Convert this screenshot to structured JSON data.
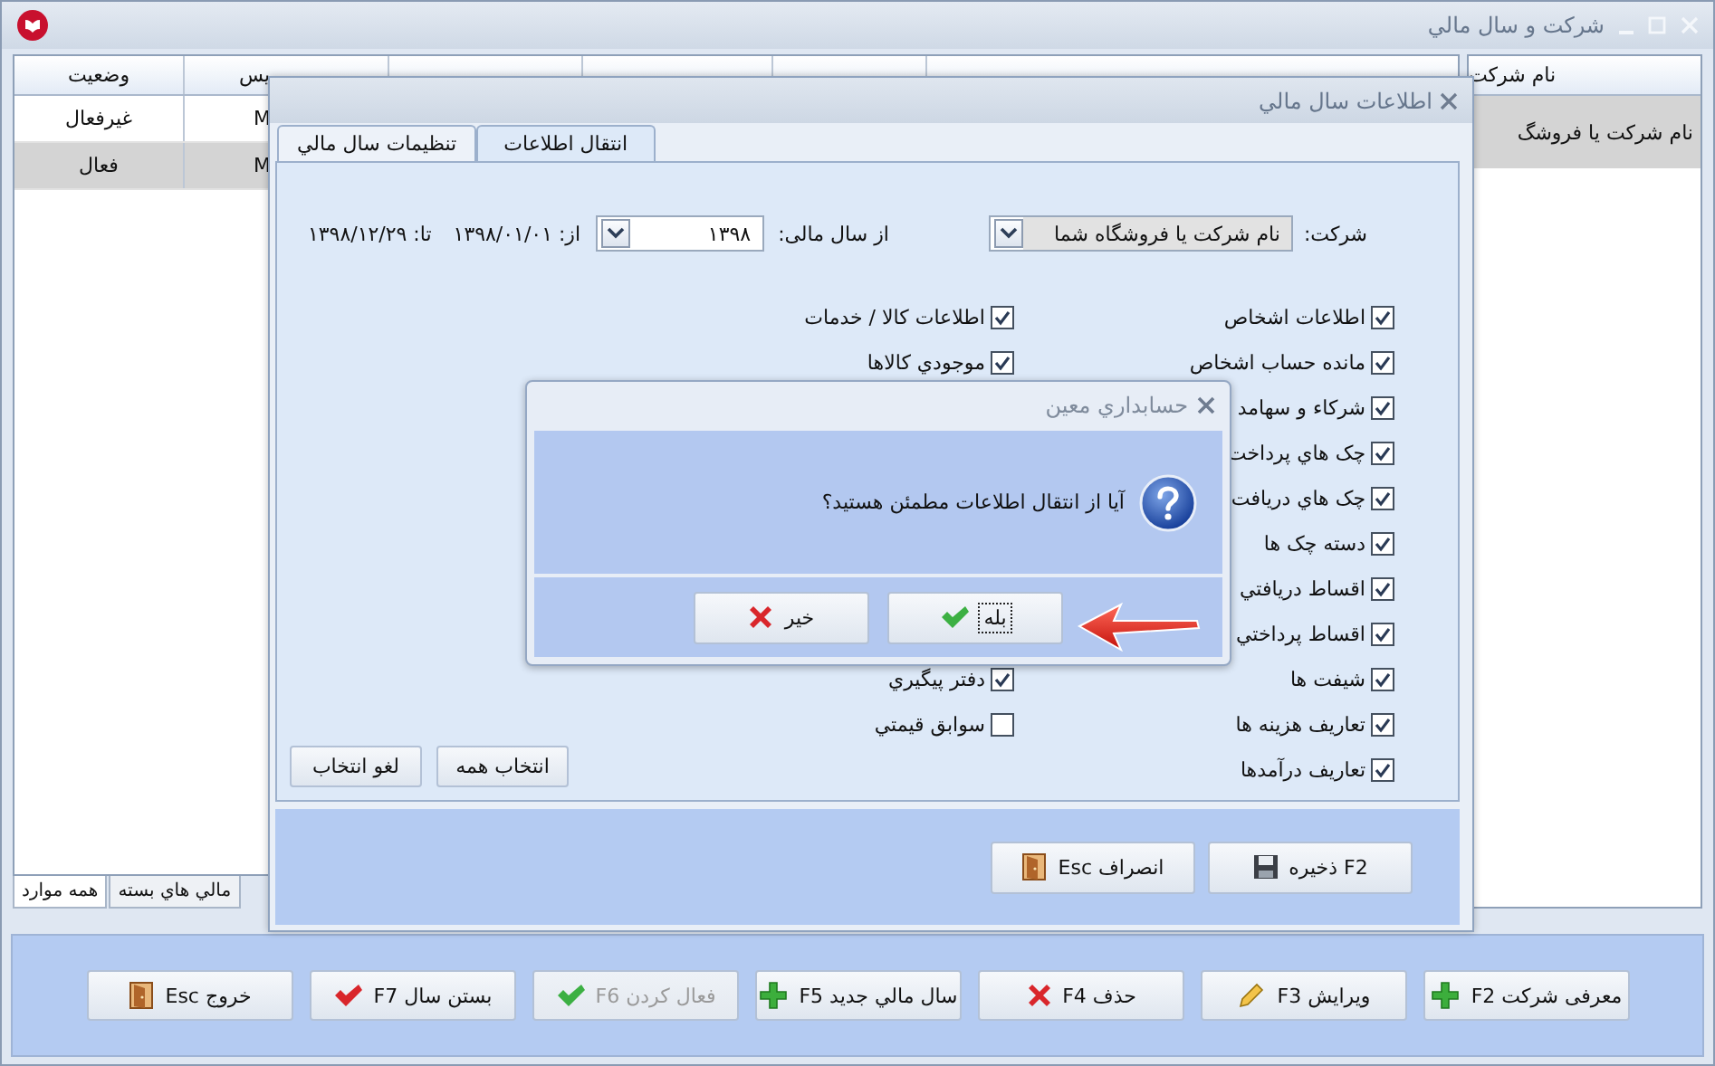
{
  "window": {
    "title": "شرکت و سال مالي"
  },
  "years_table": {
    "columns": [
      "یس",
      "وضعیت"
    ],
    "rows": [
      {
        "cells": [
          "M",
          "غیرفعال"
        ],
        "selected": false
      },
      {
        "cells": [
          "M",
          "فعال"
        ],
        "selected": true
      }
    ]
  },
  "companies_table": {
    "columns": [
      "نام شرکت"
    ],
    "rows": [
      {
        "cells": [
          "نام شرکت یا فروشگ"
        ],
        "selected": true
      }
    ]
  },
  "bottom_tabs": [
    {
      "label": "مالي هاي بسته",
      "selected": false
    },
    {
      "label": "همه موارد",
      "selected": true
    }
  ],
  "toolbar": [
    {
      "label": "معرفی شرکت F2",
      "kind": "add",
      "disabled": false
    },
    {
      "label": "ویرایش F3",
      "kind": "edit",
      "disabled": false
    },
    {
      "label": "حذف F4",
      "kind": "delete",
      "disabled": false
    },
    {
      "label": "سال مالي جدید F5",
      "kind": "add",
      "disabled": false
    },
    {
      "label": "فعال کردن F6",
      "kind": "activate",
      "disabled": true
    },
    {
      "label": "بستن سال F7",
      "kind": "close",
      "disabled": false
    },
    {
      "label": "خروج Esc",
      "kind": "exit",
      "disabled": false
    }
  ],
  "dialog": {
    "title": "اطلاعات سال مالي",
    "tabs": [
      {
        "label": "انتقال اطلاعات",
        "selected": true
      },
      {
        "label": "تنظیمات سال مالي",
        "selected": false
      }
    ],
    "company": {
      "label": "شرکت:",
      "value": "نام شرکت یا فروشگاه شما"
    },
    "year": {
      "label": "از سال مالی:",
      "value": "۱۳۹۸"
    },
    "from": "از: ۱۳۹۸/۰۱/۰۱",
    "to": "تا: ۱۳۹۸/۱۲/۲۹",
    "options_right": [
      {
        "label": "اطلاعات اشخاص",
        "checked": true
      },
      {
        "label": "مانده حساب اشخاص",
        "checked": true
      },
      {
        "label": "شرکاء و سهامد",
        "checked": true
      },
      {
        "label": "چک هاي پرداخت",
        "checked": true
      },
      {
        "label": "چک هاي دریافت",
        "checked": true
      },
      {
        "label": "دسته چک ها",
        "checked": true
      },
      {
        "label": "اقساط دریافتي",
        "checked": true
      },
      {
        "label": "اقساط پرداختي",
        "checked": true
      },
      {
        "label": "شیفت ها",
        "checked": true
      },
      {
        "label": "تعاریف هزینه ها",
        "checked": true
      },
      {
        "label": "تعاریف درآمدها",
        "checked": true
      }
    ],
    "options_left": [
      {
        "items": [
          {
            "label": "اطلاعات کالا / خدمات",
            "checked": true
          },
          {
            "label": "موجودي کالاها",
            "checked": true
          }
        ]
      },
      {
        "items": [
          {
            "label": "دفتر پیگیري",
            "checked": true
          },
          {
            "label": "سوابق قیمتي",
            "checked": false
          }
        ]
      }
    ],
    "select_buttons": [
      "انتخاب همه",
      "لغو انتخاب"
    ],
    "buttons": [
      {
        "label": "F2 ذخیره",
        "kind": "save"
      },
      {
        "label": "انصراف Esc",
        "kind": "exit"
      }
    ]
  },
  "confirm": {
    "title": "حسابداري معین",
    "message": "آیا از انتقال اطلاعات مطمئن هستید؟",
    "buttons": [
      {
        "label": "بله",
        "kind": "yes",
        "focused": true
      },
      {
        "label": "خیر",
        "kind": "no",
        "focused": false
      }
    ]
  }
}
